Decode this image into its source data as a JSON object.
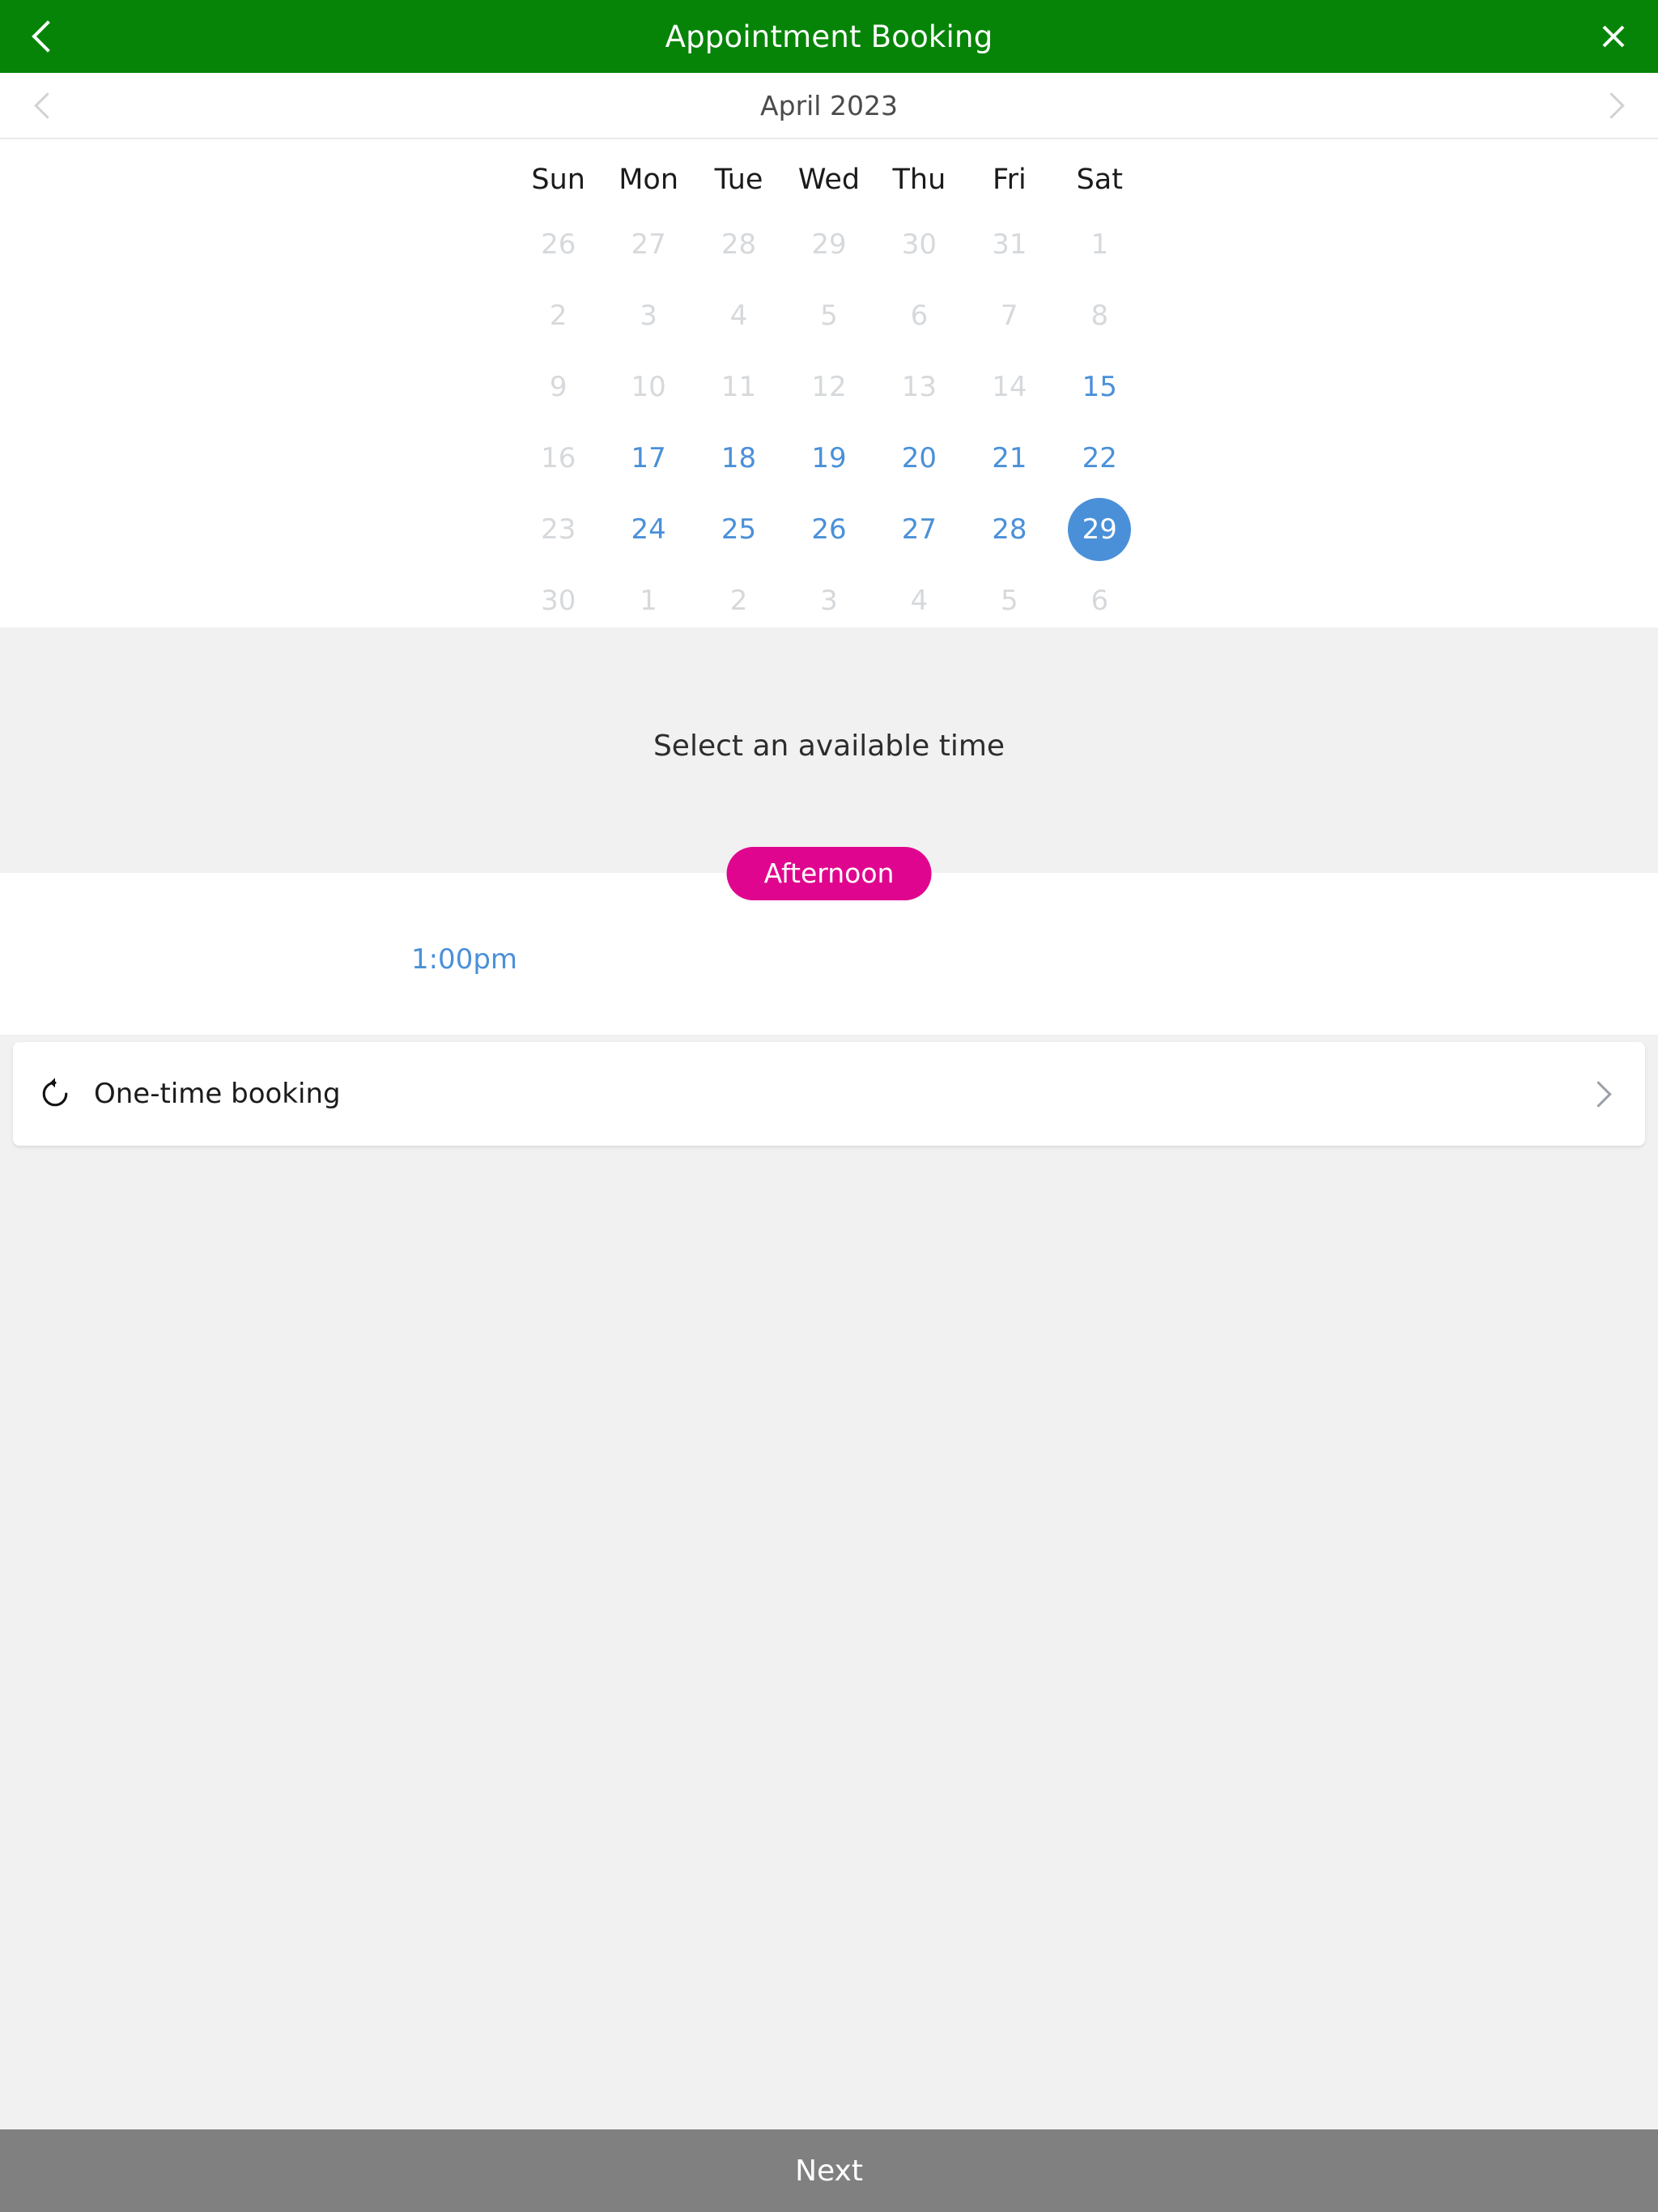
{
  "appbar": {
    "title": "Appointment Booking",
    "back_icon": "chevron-left-icon",
    "close_icon": "close-x-icon"
  },
  "month_nav": {
    "label": "April 2023",
    "prev_icon": "chevron-left-icon",
    "next_icon": "chevron-right-icon"
  },
  "calendar": {
    "weekday_headers": [
      "Sun",
      "Mon",
      "Tue",
      "Wed",
      "Thu",
      "Fri",
      "Sat"
    ],
    "selected_day": "29",
    "accent_color": "#4a90d9",
    "weeks": [
      [
        {
          "label": "26",
          "state": "muted"
        },
        {
          "label": "27",
          "state": "muted"
        },
        {
          "label": "28",
          "state": "muted"
        },
        {
          "label": "29",
          "state": "muted"
        },
        {
          "label": "30",
          "state": "muted"
        },
        {
          "label": "31",
          "state": "muted"
        },
        {
          "label": "1",
          "state": "muted"
        }
      ],
      [
        {
          "label": "2",
          "state": "muted"
        },
        {
          "label": "3",
          "state": "muted"
        },
        {
          "label": "4",
          "state": "muted"
        },
        {
          "label": "5",
          "state": "muted"
        },
        {
          "label": "6",
          "state": "muted"
        },
        {
          "label": "7",
          "state": "muted"
        },
        {
          "label": "8",
          "state": "muted"
        }
      ],
      [
        {
          "label": "9",
          "state": "muted"
        },
        {
          "label": "10",
          "state": "muted"
        },
        {
          "label": "11",
          "state": "muted"
        },
        {
          "label": "12",
          "state": "muted"
        },
        {
          "label": "13",
          "state": "muted"
        },
        {
          "label": "14",
          "state": "muted"
        },
        {
          "label": "15",
          "state": "active"
        }
      ],
      [
        {
          "label": "16",
          "state": "muted"
        },
        {
          "label": "17",
          "state": "active"
        },
        {
          "label": "18",
          "state": "active"
        },
        {
          "label": "19",
          "state": "active"
        },
        {
          "label": "20",
          "state": "active"
        },
        {
          "label": "21",
          "state": "active"
        },
        {
          "label": "22",
          "state": "active"
        }
      ],
      [
        {
          "label": "23",
          "state": "muted"
        },
        {
          "label": "24",
          "state": "active"
        },
        {
          "label": "25",
          "state": "active"
        },
        {
          "label": "26",
          "state": "active"
        },
        {
          "label": "27",
          "state": "active"
        },
        {
          "label": "28",
          "state": "active"
        },
        {
          "label": "29",
          "state": "selected"
        }
      ],
      [
        {
          "label": "30",
          "state": "muted"
        },
        {
          "label": "1",
          "state": "muted"
        },
        {
          "label": "2",
          "state": "muted"
        },
        {
          "label": "3",
          "state": "muted"
        },
        {
          "label": "4",
          "state": "muted"
        },
        {
          "label": "5",
          "state": "muted"
        },
        {
          "label": "6",
          "state": "muted"
        }
      ]
    ]
  },
  "time_section": {
    "heading": "Select an available time",
    "period_pill": {
      "label": "Afternoon",
      "color": "#e0058e",
      "selected": true
    },
    "slots": [
      {
        "label": "1:00pm"
      }
    ]
  },
  "recurrence": {
    "icon": "repeat-icon",
    "label": "One-time booking",
    "chevron_icon": "chevron-right-icon"
  },
  "footer": {
    "next_label": "Next",
    "next_enabled": false,
    "next_color": "#808080"
  }
}
